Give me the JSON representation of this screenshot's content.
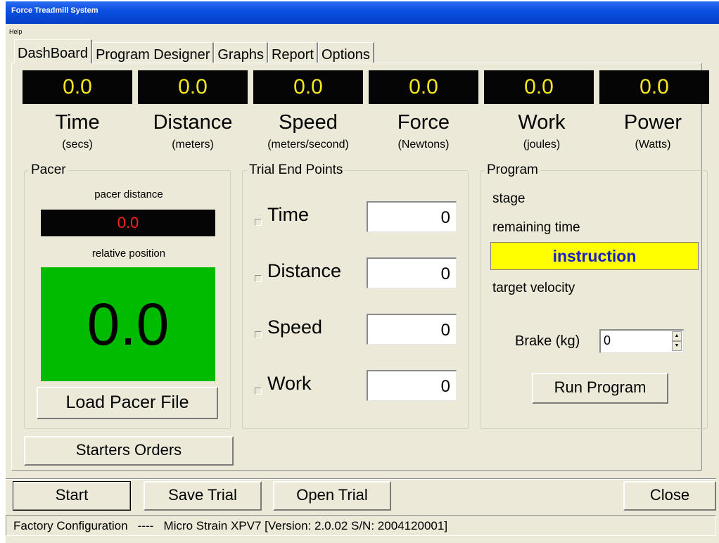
{
  "window": {
    "title": "Force Treadmill System"
  },
  "menu": {
    "items": [
      "Help"
    ]
  },
  "tabs": [
    "DashBoard",
    "Program Designer",
    "Graphs",
    "Report",
    "Options"
  ],
  "readouts": [
    {
      "value": "0.0",
      "name": "Time",
      "unit": "(secs)"
    },
    {
      "value": "0.0",
      "name": "Distance",
      "unit": "(meters)"
    },
    {
      "value": "0.0",
      "name": "Speed",
      "unit": "(meters/second)"
    },
    {
      "value": "0.0",
      "name": "Force",
      "unit": "(Newtons)"
    },
    {
      "value": "0.0",
      "name": "Work",
      "unit": "(joules)"
    },
    {
      "value": "0.0",
      "name": "Power",
      "unit": "(Watts)"
    }
  ],
  "pacer": {
    "title": "Pacer",
    "distance_label": "pacer distance",
    "distance_value": "0.0",
    "position_label": "relative position",
    "position_value": "0.0",
    "load_button": "Load Pacer File"
  },
  "end_points": {
    "title": "Trial End Points",
    "items": [
      {
        "label": "Time",
        "value": "0",
        "checked": false
      },
      {
        "label": "Distance",
        "value": "0",
        "checked": false
      },
      {
        "label": "Speed",
        "value": "0",
        "checked": false
      },
      {
        "label": "Work",
        "value": "0",
        "checked": false
      }
    ]
  },
  "program": {
    "title": "Program",
    "stage": "stage",
    "remaining_time": "remaining time",
    "instruction": "instruction",
    "target_velocity": "target velocity",
    "brake_label": "Brake (kg)",
    "brake_value": "0",
    "run_button": "Run Program"
  },
  "buttons": {
    "starters_orders": "Starters Orders",
    "start": "Start",
    "save_trial": "Save Trial",
    "open_trial": "Open Trial",
    "close": "Close"
  },
  "status": {
    "config": "Factory Configuration",
    "separator": "----",
    "device": "Micro Strain XPV7 [Version: 2.0.02 S/N: 2004120001]"
  },
  "colors": {
    "led_text": "#f5e61e",
    "pacer_red": "#ff2020",
    "pacer_green": "#00bb00",
    "instruction_bg": "#ffff00",
    "instruction_text": "#1a20c8"
  }
}
